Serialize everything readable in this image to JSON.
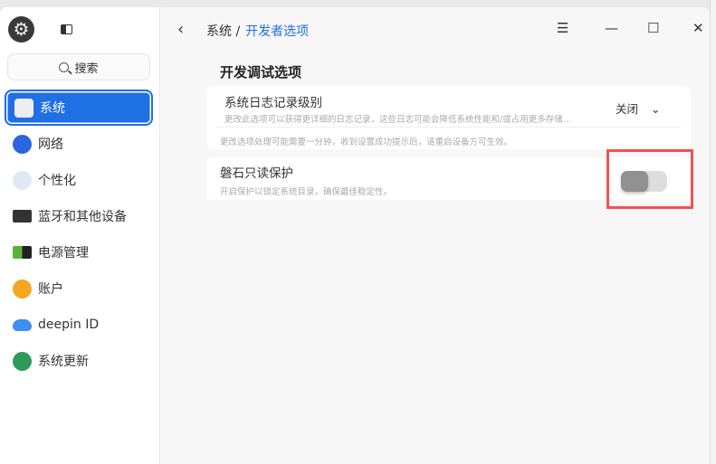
{
  "sidebar": {
    "search_label": "搜索",
    "items": [
      {
        "label": "系统",
        "icon": "system-icon",
        "active": true
      },
      {
        "label": "网络",
        "icon": "network-icon"
      },
      {
        "label": "个性化",
        "icon": "personalization-icon"
      },
      {
        "label": "蓝牙和其他设备",
        "icon": "bluetooth-devices-icon"
      },
      {
        "label": "电源管理",
        "icon": "power-icon"
      },
      {
        "label": "账户",
        "icon": "account-icon"
      },
      {
        "label": "deepin ID",
        "icon": "cloud-icon"
      },
      {
        "label": "系统更新",
        "icon": "update-icon"
      }
    ]
  },
  "breadcrumb": {
    "parent": "系统",
    "separator": "/",
    "current": "开发者选项"
  },
  "section_title": "开发调试选项",
  "log_level": {
    "title": "系统日志记录级别",
    "desc": "更改此选项可以获得更详细的日志记录，这些日志可能会降低系统性能和/或占用更多存储…",
    "value": "关闭",
    "note": "更改选项处理可能需要一分钟，收到设置成功提示后，请重启设备方可生效。"
  },
  "readonly": {
    "title": "磐石只读保护",
    "desc": "开启保护以锁定系统目录，确保最佳稳定性。",
    "enabled": false
  },
  "colors": {
    "accent": "#1f6fe5",
    "highlight": "#f25252"
  }
}
